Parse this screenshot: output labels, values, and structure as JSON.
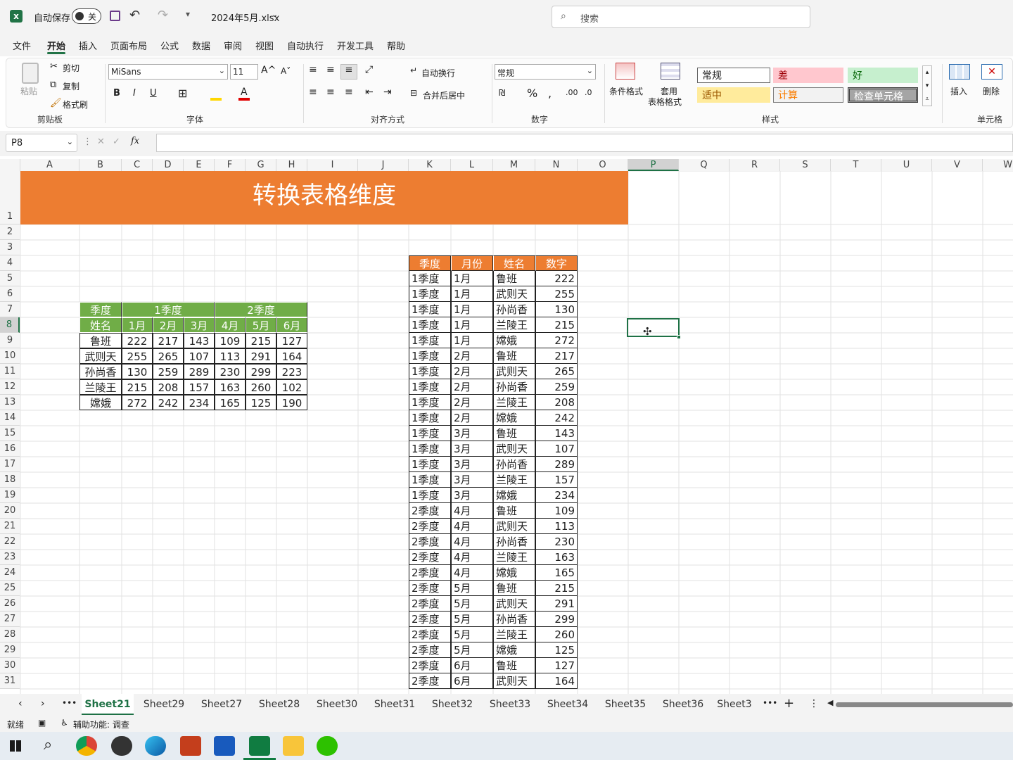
{
  "titlebar": {
    "autosave_label": "自动保存",
    "autosave_state": "关",
    "filename": "2024年5月.xlsx",
    "search_placeholder": "搜索"
  },
  "menu": [
    "文件",
    "开始",
    "插入",
    "页面布局",
    "公式",
    "数据",
    "审阅",
    "视图",
    "自动执行",
    "开发工具",
    "帮助"
  ],
  "ribbon": {
    "clipboard": {
      "paste": "粘贴",
      "cut": "剪切",
      "copy": "复制",
      "format_painter": "格式刷",
      "label": "剪贴板"
    },
    "font": {
      "name": "MiSans",
      "size": "11",
      "label": "字体"
    },
    "align": {
      "wrap": "自动换行",
      "merge": "合并后居中",
      "label": "对齐方式"
    },
    "number": {
      "format": "常规",
      "label": "数字"
    },
    "styles": {
      "cond_format": "条件格式",
      "table_format_1": "套用",
      "table_format_2": "表格格式",
      "normal": "常规",
      "bad": "差",
      "good": "好",
      "neutral": "适中",
      "calc": "计算",
      "check": "检查单元格",
      "label": "样式"
    },
    "cells": {
      "insert": "插入",
      "delete": "删除",
      "label": "单元格"
    }
  },
  "formula_bar": {
    "name_box": "P8",
    "fx": "fx",
    "formula": ""
  },
  "columns": [
    "A",
    "B",
    "C",
    "D",
    "E",
    "F",
    "G",
    "H",
    "I",
    "J",
    "K",
    "L",
    "M",
    "N",
    "O",
    "P",
    "Q",
    "R",
    "S",
    "T",
    "U",
    "V",
    "W"
  ],
  "rows": [
    "1",
    "2",
    "3",
    "4",
    "5",
    "6",
    "7",
    "8",
    "9",
    "10",
    "11",
    "12",
    "13",
    "14",
    "15",
    "16",
    "17",
    "18",
    "19",
    "20",
    "21",
    "22",
    "23",
    "24",
    "25",
    "26",
    "27",
    "28",
    "29",
    "30",
    "31"
  ],
  "sheet_title": "转换表格维度",
  "pivot": {
    "hdr1": [
      "季度",
      "1季度",
      "2季度"
    ],
    "hdr2": [
      "姓名",
      "1月",
      "2月",
      "3月",
      "4月",
      "5月",
      "6月"
    ],
    "rows": [
      [
        "鲁班",
        "222",
        "217",
        "143",
        "109",
        "215",
        "127"
      ],
      [
        "武则天",
        "255",
        "265",
        "107",
        "113",
        "291",
        "164"
      ],
      [
        "孙尚香",
        "130",
        "259",
        "289",
        "230",
        "299",
        "223"
      ],
      [
        "兰陵王",
        "215",
        "208",
        "157",
        "163",
        "260",
        "102"
      ],
      [
        "嫦娥",
        "272",
        "242",
        "234",
        "165",
        "125",
        "190"
      ]
    ]
  },
  "flat": {
    "headers": [
      "季度",
      "月份",
      "姓名",
      "数字"
    ],
    "rows": [
      [
        "1季度",
        "1月",
        "鲁班",
        "222"
      ],
      [
        "1季度",
        "1月",
        "武则天",
        "255"
      ],
      [
        "1季度",
        "1月",
        "孙尚香",
        "130"
      ],
      [
        "1季度",
        "1月",
        "兰陵王",
        "215"
      ],
      [
        "1季度",
        "1月",
        "嫦娥",
        "272"
      ],
      [
        "1季度",
        "2月",
        "鲁班",
        "217"
      ],
      [
        "1季度",
        "2月",
        "武则天",
        "265"
      ],
      [
        "1季度",
        "2月",
        "孙尚香",
        "259"
      ],
      [
        "1季度",
        "2月",
        "兰陵王",
        "208"
      ],
      [
        "1季度",
        "2月",
        "嫦娥",
        "242"
      ],
      [
        "1季度",
        "3月",
        "鲁班",
        "143"
      ],
      [
        "1季度",
        "3月",
        "武则天",
        "107"
      ],
      [
        "1季度",
        "3月",
        "孙尚香",
        "289"
      ],
      [
        "1季度",
        "3月",
        "兰陵王",
        "157"
      ],
      [
        "1季度",
        "3月",
        "嫦娥",
        "234"
      ],
      [
        "2季度",
        "4月",
        "鲁班",
        "109"
      ],
      [
        "2季度",
        "4月",
        "武则天",
        "113"
      ],
      [
        "2季度",
        "4月",
        "孙尚香",
        "230"
      ],
      [
        "2季度",
        "4月",
        "兰陵王",
        "163"
      ],
      [
        "2季度",
        "4月",
        "嫦娥",
        "165"
      ],
      [
        "2季度",
        "5月",
        "鲁班",
        "215"
      ],
      [
        "2季度",
        "5月",
        "武则天",
        "291"
      ],
      [
        "2季度",
        "5月",
        "孙尚香",
        "299"
      ],
      [
        "2季度",
        "5月",
        "兰陵王",
        "260"
      ],
      [
        "2季度",
        "5月",
        "嫦娥",
        "125"
      ],
      [
        "2季度",
        "6月",
        "鲁班",
        "127"
      ],
      [
        "2季度",
        "6月",
        "武则天",
        "164"
      ]
    ]
  },
  "sheet_tabs": [
    "Sheet21",
    "Sheet29",
    "Sheet27",
    "Sheet28",
    "Sheet30",
    "Sheet31",
    "Sheet32",
    "Sheet33",
    "Sheet34",
    "Sheet35",
    "Sheet36",
    "Sheet3"
  ],
  "active_tab": "Sheet21",
  "status": {
    "ready": "就绪",
    "accessibility": "辅助功能: 调查"
  },
  "colors": {
    "orange": "#ed7d31",
    "green": "#70ad47",
    "excel_green": "#217346",
    "selection": "#1e7145"
  },
  "taskbar_icons": [
    "windows-start-icon",
    "search-icon",
    "chrome-icon",
    "obs-icon",
    "edge-icon",
    "powerpoint-icon",
    "word-icon",
    "excel-icon",
    "file-explorer-icon",
    "wechat-icon"
  ]
}
